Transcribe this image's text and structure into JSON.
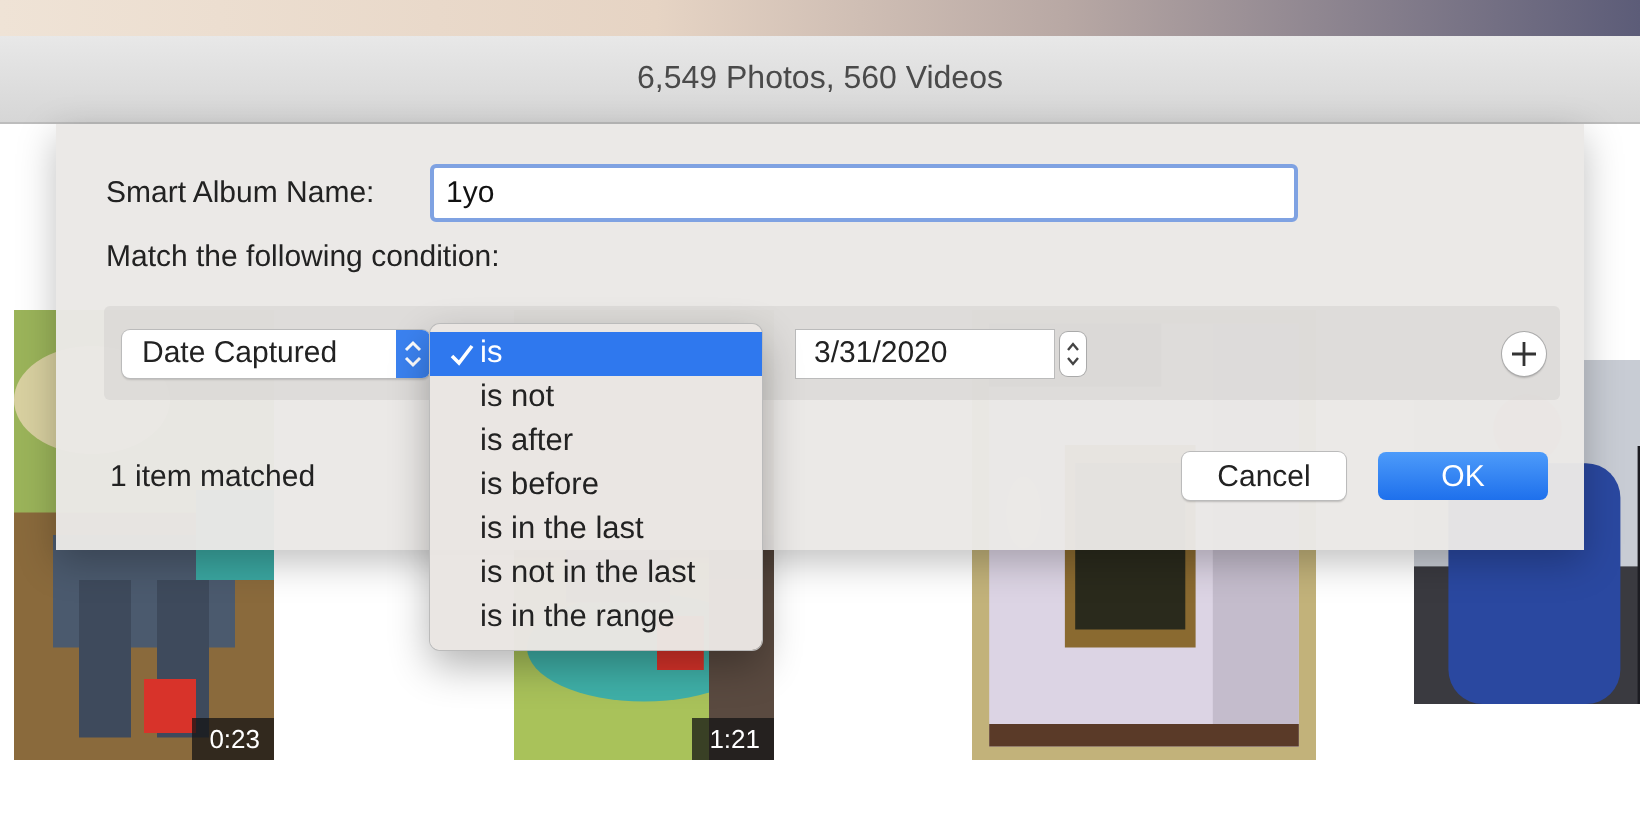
{
  "window": {
    "title": "6,549 Photos, 560 Videos"
  },
  "thumbnails": [
    {
      "kind": "picture",
      "duration": "0:23"
    },
    {
      "kind": "picture",
      "duration": "1:21"
    },
    {
      "kind": "picture"
    },
    {
      "kind": "picture"
    }
  ],
  "dialog": {
    "name_label": "Smart Album Name:",
    "name_value": "1yo",
    "match_label": "Match the following condition:",
    "condition": {
      "field": "Date Captured",
      "date": "3/31/2020",
      "operator_menu": [
        {
          "label": "is",
          "selected": true
        },
        {
          "label": "is not",
          "selected": false
        },
        {
          "label": "is after",
          "selected": false
        },
        {
          "label": "is before",
          "selected": false
        },
        {
          "label": "is in the last",
          "selected": false
        },
        {
          "label": "is not in the last",
          "selected": false
        },
        {
          "label": "is in the range",
          "selected": false
        }
      ]
    },
    "status": "1 item matched",
    "buttons": [
      {
        "label": "Cancel",
        "kind": "secondary"
      },
      {
        "label": "OK",
        "kind": "default"
      }
    ]
  }
}
